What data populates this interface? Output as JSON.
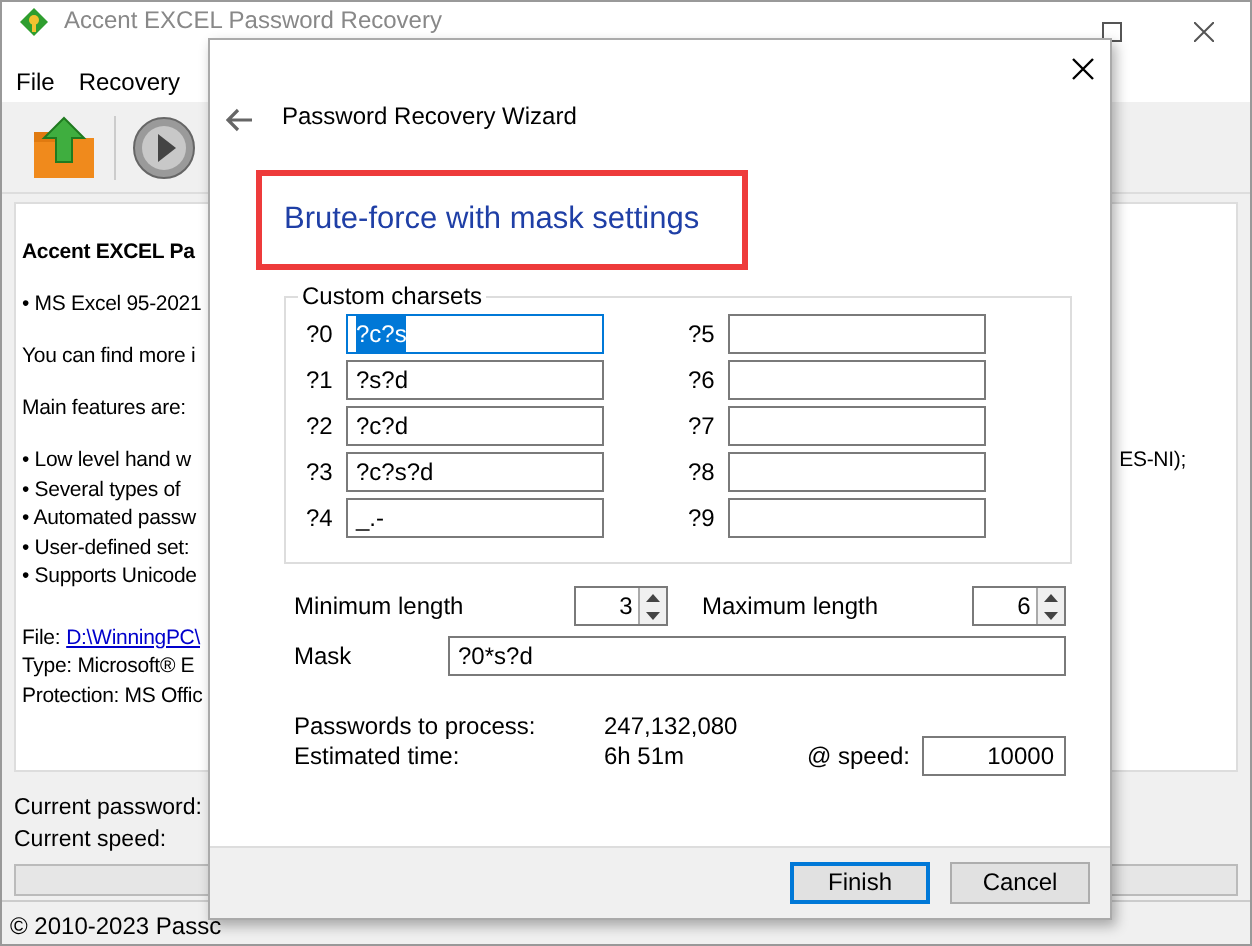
{
  "window": {
    "title": "Accent EXCEL Password Recovery"
  },
  "menu": [
    "File",
    "Recovery"
  ],
  "info": {
    "heading": "Accent EXCEL Pa",
    "version_line": "• MS Excel 95-2021",
    "more": "You can find more i",
    "features_title": "Main features are:",
    "features": [
      "• Low level hand w",
      "• Several types of",
      "• Automated passw",
      "• User-defined set:",
      "• Supports Unicode"
    ],
    "features_tail": "ES-NI);",
    "file_label": "File:",
    "file_path": "D:\\WinningPC\\",
    "type": "Type: Microsoft® E",
    "protection": "Protection: MS Offic"
  },
  "progress": {
    "current_password": "Current password:",
    "current_speed": "Current speed:",
    "level": 0
  },
  "status_bar": "© 2010-2023 Passc",
  "dialog": {
    "title": "Password Recovery Wizard",
    "heading": "Brute-force with mask settings",
    "charsets_title": "Custom charsets",
    "charsets": [
      {
        "label": "?0",
        "value": "?c?s",
        "focused": true
      },
      {
        "label": "?1",
        "value": "?s?d",
        "focused": false
      },
      {
        "label": "?2",
        "value": "?c?d",
        "focused": false
      },
      {
        "label": "?3",
        "value": "?c?s?d",
        "focused": false
      },
      {
        "label": "?4",
        "value": "_.-",
        "focused": false
      },
      {
        "label": "?5",
        "focused": false
      },
      {
        "label": "?6",
        "focused": false
      },
      {
        "label": "?7",
        "focused": false
      },
      {
        "label": "?8",
        "focused": false
      },
      {
        "label": "?9",
        "focused": false
      }
    ],
    "min_length": {
      "label": "Minimum length",
      "value": "3"
    },
    "max_length": {
      "label": "Maximum length",
      "value": "6"
    },
    "mask": {
      "label": "Mask",
      "value": "?0*s?d"
    },
    "passwords_label": "Passwords to process:",
    "passwords_value": "247,132,080",
    "time_label": "Estimated time:",
    "time_value": "6h 51m",
    "speed_label": "@ speed:",
    "speed_value": "10000",
    "buttons": [
      {
        "label": "Finish",
        "default": true
      },
      {
        "label": "Cancel",
        "default": false
      }
    ]
  }
}
